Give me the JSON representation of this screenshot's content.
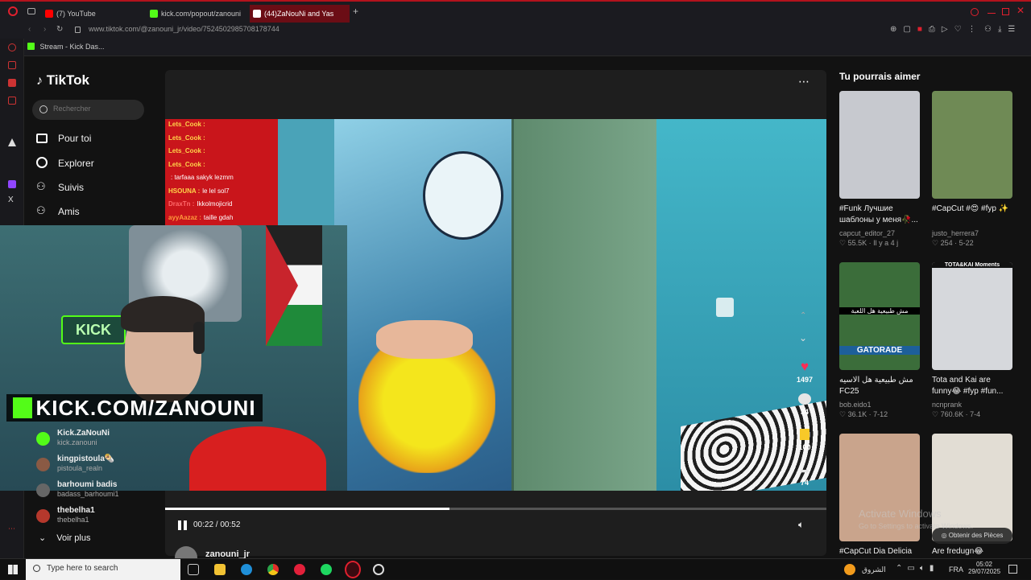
{
  "browser": {
    "tabs": [
      {
        "label": "(7) YouTube",
        "color": "#ff0000"
      },
      {
        "label": "kick.com/popout/zanouni",
        "color": "#53fc18"
      },
      {
        "label": "(44)ZaNouNi and Yas",
        "color": "#ffffff"
      }
    ],
    "url": "www.tiktok.com/@zanouni_jr/video/7524502985708178744",
    "bookmark": "Stream - Kick Das..."
  },
  "tiktok": {
    "logo": "TikTok",
    "search_placeholder": "Rechercher",
    "nav": [
      {
        "label": "Pour toi",
        "icon": "home-icon"
      },
      {
        "label": "Explorer",
        "icon": "compass-icon"
      },
      {
        "label": "Suivis",
        "icon": "following-icon"
      },
      {
        "label": "Amis",
        "icon": "friends-icon"
      }
    ],
    "following": [
      {
        "name": "Kick.ZaNouNi",
        "handle": "kick.zanouni"
      },
      {
        "name": "kingpistoula🌯",
        "handle": "pistoula_realn"
      },
      {
        "name": "barhoumi badis",
        "handle": "badass_barhoumi1"
      },
      {
        "name": "thebelha1",
        "handle": "thebelha1"
      }
    ],
    "see_more": "Voir plus"
  },
  "video": {
    "chat": [
      {
        "user": "Lets_Cook :",
        "msg": "",
        "color": "#ffd54a"
      },
      {
        "user": "Lets_Cook :",
        "msg": "",
        "color": "#ffd54a"
      },
      {
        "user": "Lets_Cook :",
        "msg": "",
        "color": "#ffd54a"
      },
      {
        "user": "Lets_Cook :",
        "msg": "",
        "color": "#ffd54a"
      },
      {
        "user": "",
        "msg": ": tarfaaa sakyk lezmm",
        "color": "#9be37a"
      },
      {
        "user": "HSOUNA :",
        "msg": "le lel sol7",
        "color": "#ffd54a"
      },
      {
        "user": "DraxTn :",
        "msg": "Ikkolmojicrid",
        "color": "#ff6b6b"
      },
      {
        "user": "ayyAazaz :",
        "msg": "taille gdah",
        "color": "#ff9a3c"
      }
    ],
    "overlay_text": "KICK.COM/ZANOUNI",
    "kick_sign": "KICK",
    "likes": "1497",
    "comments": "34",
    "saves": "100",
    "shares": "74",
    "time": "00:22 / 00:52",
    "progress": 0.43,
    "author_partial": "zanouni_jr"
  },
  "recommend": {
    "title": "Tu pourrais aimer",
    "cards": [
      {
        "desc": "#Funk Лучшие шаблоны у меня🥀...",
        "author": "capcut_editor_27",
        "likes": "55.5K",
        "date": "Il y a 4 j",
        "bg": "#c7c9cf"
      },
      {
        "desc": "#CapCut #😍 #fyp ✨",
        "author": "justo_herrera7",
        "likes": "254",
        "date": "5-22",
        "bg": "#6f8a55"
      },
      {
        "desc": "مش طبيعية هل الاسيه FC25 #متحت_تشامبينز_يقها...",
        "author": "bob.eido1",
        "likes": "36.1K",
        "date": "7-12",
        "bg": "#3b6d3a"
      },
      {
        "desc": "Tota and Kai are funny😂 #fyp #fun...",
        "author": "ncnprank",
        "likes": "760.6K",
        "date": "7-4",
        "bg": "#d6d8dc"
      },
      {
        "desc": "#CapCut Dia Delicia",
        "author": "",
        "likes": "",
        "date": "",
        "bg": "#c9a48c"
      },
      {
        "desc": "Are fredugn😂",
        "author": "",
        "likes": "",
        "date": "",
        "bg": "#e2ddd4"
      }
    ],
    "overlay_label": "TOTA&KAI Moments",
    "gatorade": "GATORADE",
    "arabic_label": "مش طبيعية هل اللعبة"
  },
  "watermark": {
    "line1": "Activate Windows",
    "line2": "Go to Settings to activate Windows."
  },
  "coins_button": "Obtenir des Pièces",
  "taskbar": {
    "search": "Type here to search",
    "weather": "الشروق",
    "lang": "FRA",
    "time": "05:02",
    "date": "29/07/2025"
  }
}
